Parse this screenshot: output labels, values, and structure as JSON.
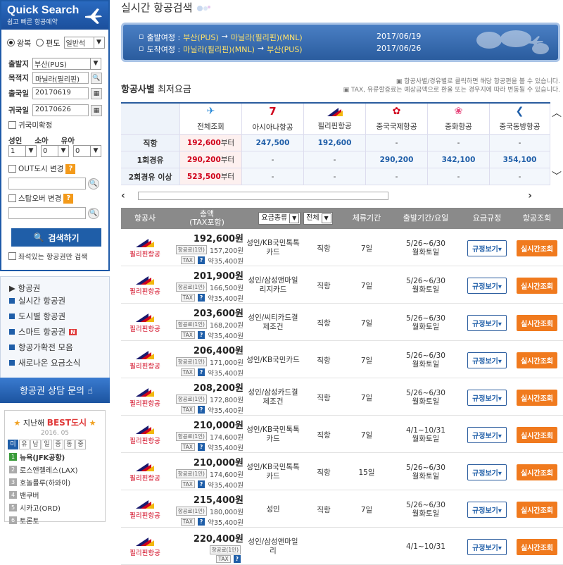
{
  "sidebar": {
    "title": "Quick Search",
    "subtitle": "쉽고 빠른 항공예약",
    "trip_types": [
      "왕복",
      "편도"
    ],
    "class_select": "일반석",
    "origin_label": "출발지",
    "origin_value": "부산(PUS)",
    "dest_label": "목적지",
    "dest_value": "마닐라(필리핀)",
    "depart_label": "출국일",
    "depart_value": "20170619",
    "return_label": "귀국일",
    "return_value": "20170626",
    "undecided_label": "귀국미확정",
    "pax_labels": [
      "성인",
      "소아",
      "유아"
    ],
    "pax_values": [
      "1",
      "0",
      "0"
    ],
    "out_city_label": "OUT도시 변경",
    "stopover_label": "스탑오버 변경",
    "search_button": "검색하기",
    "seats_only_label": "좌석있는 항공권만 검색",
    "menu_header": "▶ 항공권",
    "menu_items": [
      "실시간 항공권",
      "도시별 항공권",
      "스마트 항공권",
      "항공가확전 모음",
      "새로나온 요금소식"
    ],
    "new_badge": "N",
    "consult_button": "항공권 상담 문의",
    "best": {
      "prefix": "지난해",
      "bold": "BEST",
      "suffix": "도시",
      "date": "2016. 05",
      "tabs": [
        "미",
        "유",
        "남",
        "일",
        "중",
        "동",
        "중"
      ],
      "ranks": [
        "뉴욕(JFK공항)",
        "로스앤젤레스(LAX)",
        "호놀룰루(하와이)",
        "밴쿠버",
        "시카고(ORD)",
        "토론토"
      ]
    }
  },
  "header": {
    "title": "실시간 항공검색"
  },
  "route": {
    "depart_label": "출발여정 :",
    "depart_from": "부산(PUS)",
    "depart_arrow": "→",
    "depart_to": "마닐라(필리핀)(MNL)",
    "depart_date": "2017/06/19",
    "return_label": "도착여정 :",
    "return_from": "마닐라(필리핀)(MNL)",
    "return_arrow": "→",
    "return_to": "부산(PUS)",
    "return_date": "2017/06/26"
  },
  "section": {
    "title_bold": "항공사별",
    "title_rest": " 최저요금",
    "note1": "항공사별/경유별로 클릭하면 해당 항공편을 볼 수 있습니다.",
    "note2": "TAX, 유류할증료는 예상금액으로 환율 또는 경우지에 따라 변동될 수 있습니다."
  },
  "matrix": {
    "airlines": [
      "전체조회",
      "아시아나항공",
      "필리핀항공",
      "중국국제항공",
      "중화항공",
      "중국동방항공"
    ],
    "rows": [
      {
        "label": "직항",
        "all": "192,600",
        "suffix": "부터",
        "vals": [
          "247,500",
          "192,600",
          "-",
          "-",
          "-"
        ]
      },
      {
        "label": "1회경유",
        "all": "290,200",
        "suffix": "부터",
        "vals": [
          "-",
          "-",
          "290,200",
          "342,100",
          "354,100"
        ]
      },
      {
        "label": "2회경유 이상",
        "all": "523,500",
        "suffix": "부터",
        "vals": [
          "-",
          "-",
          "-",
          "-",
          "-"
        ]
      }
    ]
  },
  "results": {
    "headers": {
      "airline": "항공사",
      "total": "총액",
      "total_sub": "(TAX포함)",
      "fare_type": "요금종류",
      "fare_filter": "전체",
      "stay": "체류기간",
      "period": "출발기간/요일",
      "rules": "요금규정",
      "lookup": "항공조회"
    },
    "rows": [
      {
        "airline": "필리핀항공",
        "price": "192,600원",
        "fare": "157,200원",
        "tax": "약35,400원",
        "card": "성인/KB국민톡톡카드",
        "type": "직항",
        "stay": "7일",
        "period": "5/26~6/30",
        "days": "월화토일"
      },
      {
        "airline": "필리핀항공",
        "price": "201,900원",
        "fare": "166,500원",
        "tax": "약35,400원",
        "card": "성인/삼성앤마일리지카드",
        "type": "직항",
        "stay": "7일",
        "period": "5/26~6/30",
        "days": "월화토일"
      },
      {
        "airline": "필리핀항공",
        "price": "203,600원",
        "fare": "168,200원",
        "tax": "약35,400원",
        "card": "성인/씨티카드결제조건",
        "type": "직항",
        "stay": "7일",
        "period": "5/26~6/30",
        "days": "월화토일"
      },
      {
        "airline": "필리핀항공",
        "price": "206,400원",
        "fare": "171,000원",
        "tax": "약35,400원",
        "card": "성인/KB국민카드",
        "type": "직항",
        "stay": "7일",
        "period": "5/26~6/30",
        "days": "월화토일"
      },
      {
        "airline": "필리핀항공",
        "price": "208,200원",
        "fare": "172,800원",
        "tax": "약35,400원",
        "card": "성인/삼성카드결제조건",
        "type": "직항",
        "stay": "7일",
        "period": "5/26~6/30",
        "days": "월화토일"
      },
      {
        "airline": "필리핀항공",
        "price": "210,000원",
        "fare": "174,600원",
        "tax": "약35,400원",
        "card": "성인/KB국민톡톡카드",
        "type": "직항",
        "stay": "7일",
        "period": "4/1~10/31",
        "days": "월화토일"
      },
      {
        "airline": "필리핀항공",
        "price": "210,000원",
        "fare": "174,600원",
        "tax": "약35,400원",
        "card": "성인/KB국민톡톡카드",
        "type": "직항",
        "stay": "15일",
        "period": "5/26~6/30",
        "days": "월화토일"
      },
      {
        "airline": "필리핀항공",
        "price": "215,400원",
        "fare": "180,000원",
        "tax": "약35,400원",
        "card": "성인",
        "type": "직항",
        "stay": "7일",
        "period": "5/26~6/30",
        "days": "월화토일"
      },
      {
        "airline": "필리핀항공",
        "price": "220,400원",
        "fare": "",
        "tax": "",
        "card": "성인/삼성앤마일리",
        "type": "",
        "stay": "",
        "period": "4/1~10/31",
        "days": ""
      }
    ],
    "fare_tag": "항공료(1인)",
    "tax_tag": "TAX",
    "q_tag": "?",
    "rule_button": "규정보기▾",
    "live_button": "실시간조회"
  }
}
